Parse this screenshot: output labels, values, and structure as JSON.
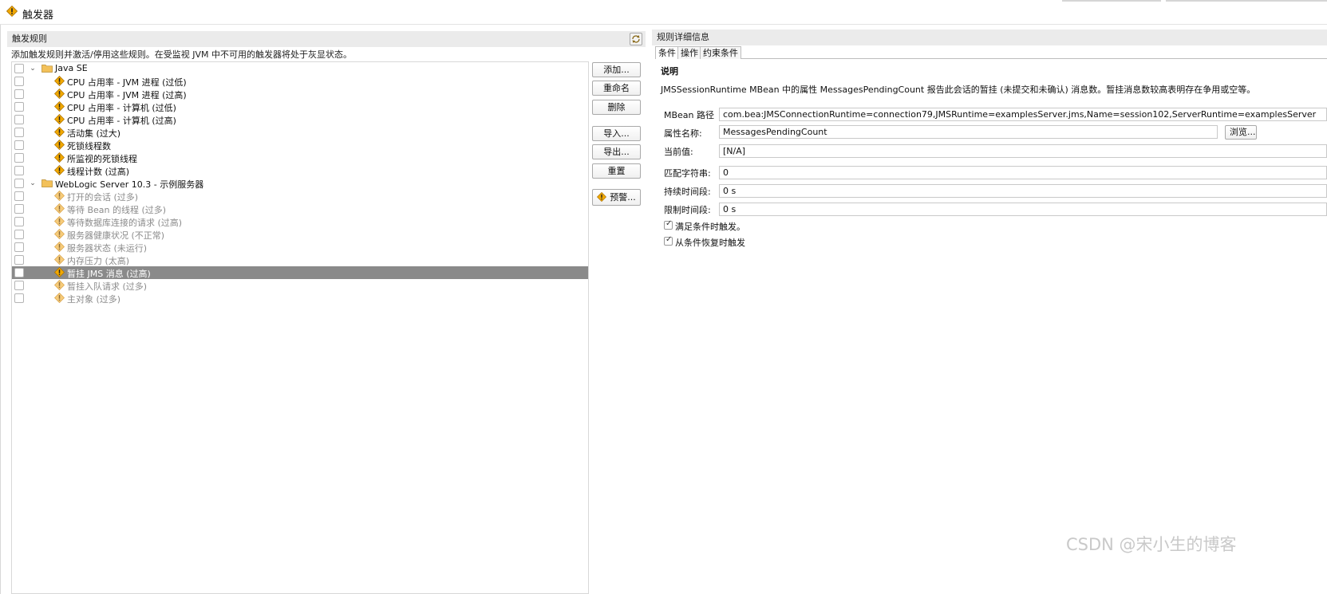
{
  "header": {
    "title": "触发器"
  },
  "rules_panel": {
    "title": "触发规则",
    "hint": "添加触发规则并激活/停用这些规则。在受监视 JVM 中不可用的触发器将处于灰显状态。",
    "groups": [
      {
        "label": "Java SE",
        "items": [
          {
            "label": "CPU 占用率 - JVM 进程 (过低)",
            "dim": false,
            "selected": false
          },
          {
            "label": "CPU 占用率 - JVM 进程 (过高)",
            "dim": false,
            "selected": false
          },
          {
            "label": "CPU 占用率 - 计算机 (过低)",
            "dim": false,
            "selected": false
          },
          {
            "label": "CPU 占用率 - 计算机 (过高)",
            "dim": false,
            "selected": false
          },
          {
            "label": "活动集 (过大)",
            "dim": false,
            "selected": false
          },
          {
            "label": "死锁线程数",
            "dim": false,
            "selected": false
          },
          {
            "label": "所监视的死锁线程",
            "dim": false,
            "selected": false
          },
          {
            "label": "线程计数 (过高)",
            "dim": false,
            "selected": false
          }
        ]
      },
      {
        "label": "WebLogic Server 10.3 - 示例服务器",
        "items": [
          {
            "label": "打开的会话 (过多)",
            "dim": true,
            "selected": false
          },
          {
            "label": "等待 Bean 的线程 (过多)",
            "dim": true,
            "selected": false
          },
          {
            "label": "等待数据库连接的请求 (过高)",
            "dim": true,
            "selected": false
          },
          {
            "label": "服务器健康状况 (不正常)",
            "dim": true,
            "selected": false
          },
          {
            "label": "服务器状态 (未运行)",
            "dim": true,
            "selected": false
          },
          {
            "label": "内存压力 (太高)",
            "dim": true,
            "selected": false
          },
          {
            "label": "暂挂 JMS 消息 (过高)",
            "dim": false,
            "selected": true
          },
          {
            "label": "暂挂入队请求 (过多)",
            "dim": true,
            "selected": false
          },
          {
            "label": "主对象 (过多)",
            "dim": true,
            "selected": false
          }
        ]
      }
    ]
  },
  "buttons": {
    "add": "添加...",
    "rename": "重命名",
    "delete": "删除",
    "import": "导入...",
    "export": "导出...",
    "reset": "重置",
    "alert": "预警..."
  },
  "details": {
    "title": "规则详细信息",
    "tabs": [
      "条件",
      "操作",
      "约束条件"
    ],
    "desc_heading": "说明",
    "description": "JMSSessionRuntime MBean 中的属性 MessagesPendingCount 报告此会话的暂挂 (未提交和未确认) 消息数。暂挂消息数较高表明存在争用或空等。",
    "mbean_label": "MBean 路径",
    "mbean_value": "com.bea:JMSConnectionRuntime=connection79,JMSRuntime=examplesServer.jms,Name=session102,ServerRuntime=examplesServer",
    "attr_label": "属性名称:",
    "attr_value": "MessagesPendingCount",
    "browse_label": "浏览...",
    "current_label": "当前值:",
    "current_value": "[N/A]",
    "match_label": "匹配字符串:",
    "match_value": "0",
    "duration_label": "持续时间段:",
    "duration_value": "0 s",
    "limit_label": "限制时间段:",
    "limit_value": "0 s",
    "trigger_on_label": "满足条件时触发。",
    "trigger_recover_label": "从条件恢复时触发"
  },
  "watermark": "CSDN @宋小生的博客",
  "colors": {
    "warn_fill": "#f2a900",
    "warn_dim": "#f7cc7a",
    "selection": "#8a8a8a",
    "folder": "#f3c15a"
  }
}
